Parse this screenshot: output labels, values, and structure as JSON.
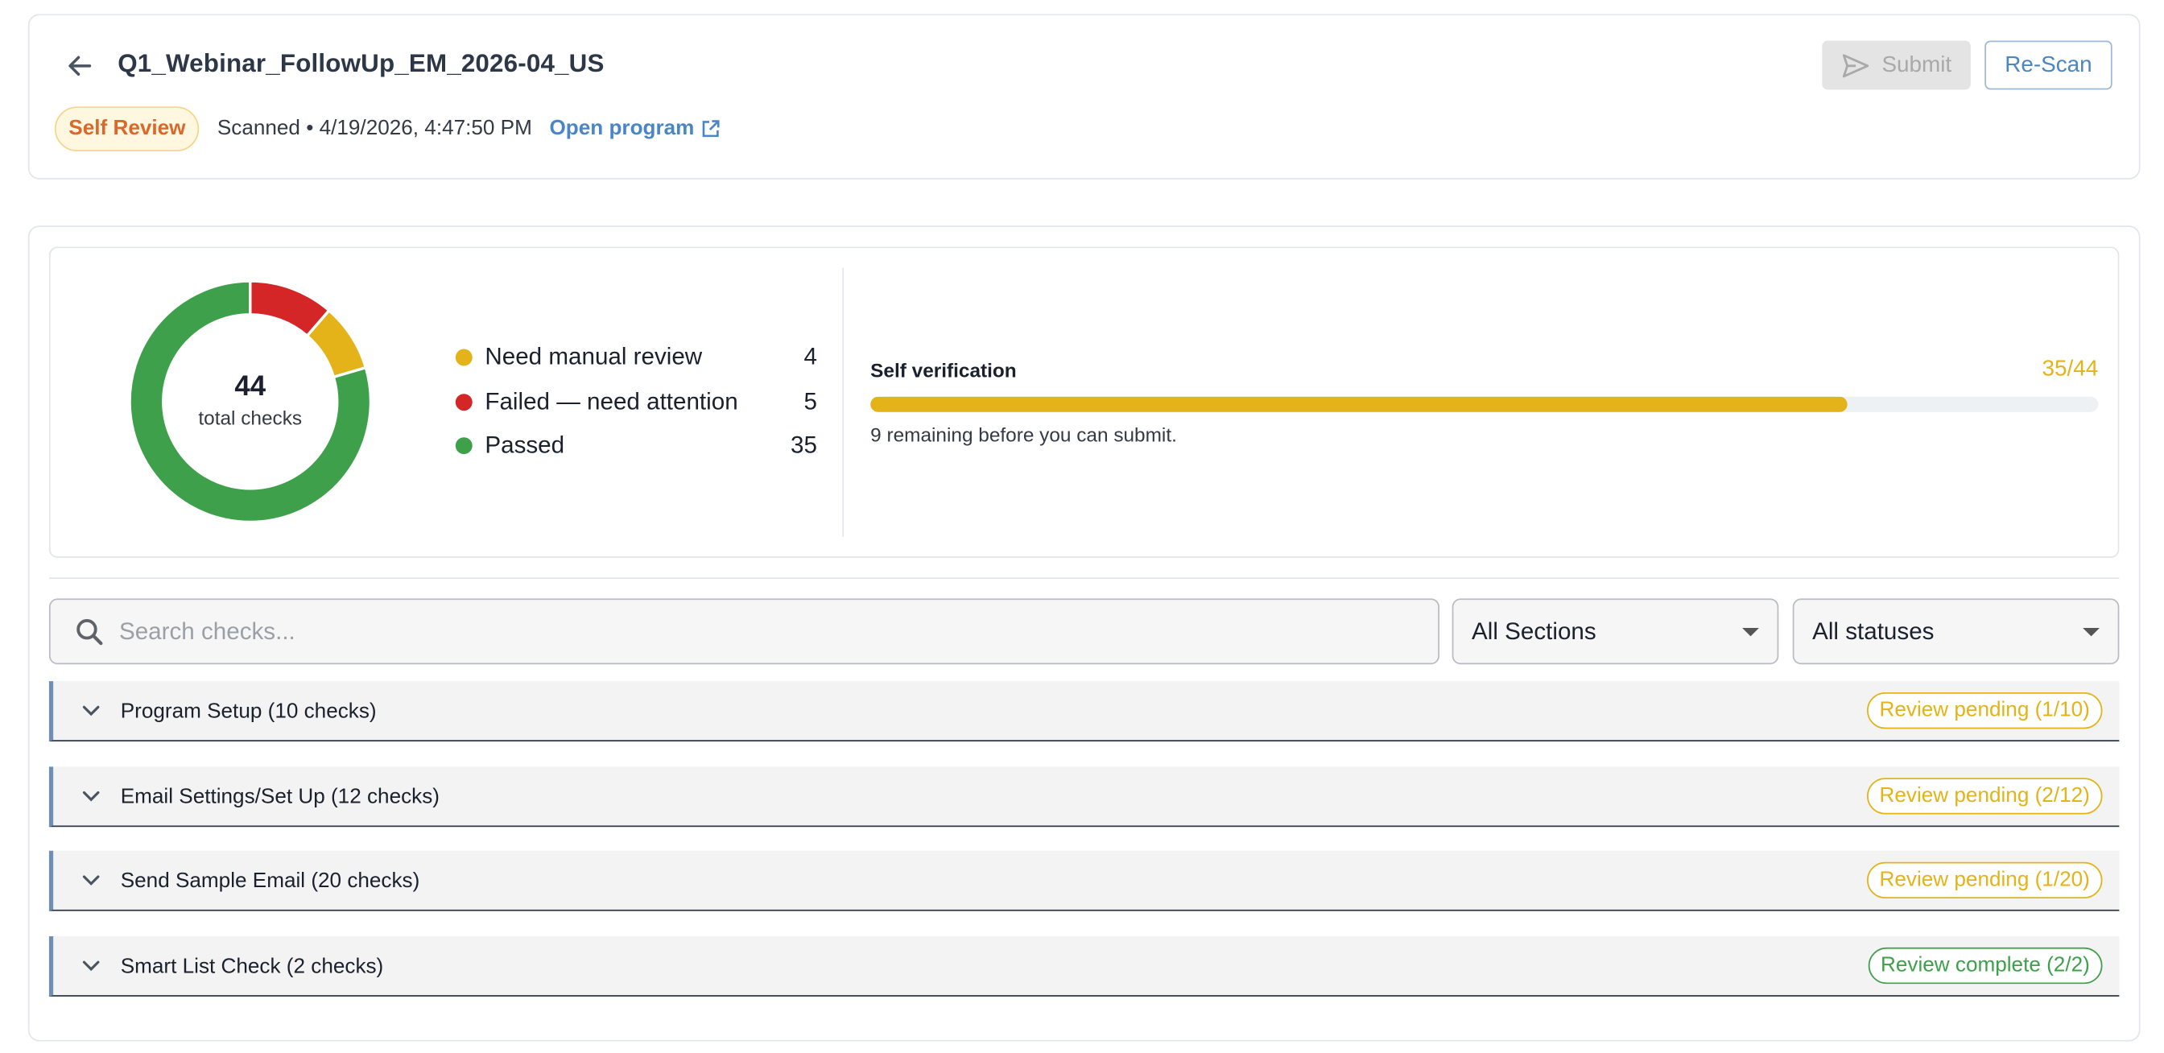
{
  "header": {
    "title": "Q1_Webinar_FollowUp_EM_2026-04_US",
    "badge": "Self Review",
    "scanned_text": "Scanned • 4/19/2026, 4:47:50 PM",
    "open_program_label": "Open program",
    "submit_label": "Submit",
    "rescan_label": "Re-Scan"
  },
  "summary": {
    "total": "44",
    "total_label": "total checks",
    "legend": [
      {
        "label": "Need manual review",
        "count": "4",
        "color": "#e3b319"
      },
      {
        "label": "Failed — need attention",
        "count": "5",
        "color": "#d42626"
      },
      {
        "label": "Passed",
        "count": "35",
        "color": "#3ea04a"
      }
    ]
  },
  "self_verification": {
    "title": "Self verification",
    "count_text": "35/44",
    "progress_fraction": 0.7955,
    "remaining_text": "9 remaining before you can submit."
  },
  "filters": {
    "search_placeholder": "Search checks...",
    "section_select": "All Sections",
    "status_select": "All statuses"
  },
  "sections": [
    {
      "label": "Program Setup (10 checks)",
      "status": "Review pending (1/10)",
      "state": "pending"
    },
    {
      "label": "Email Settings/Set Up (12 checks)",
      "status": "Review pending (2/12)",
      "state": "pending"
    },
    {
      "label": "Send Sample Email (20 checks)",
      "status": "Review pending (1/20)",
      "state": "pending"
    },
    {
      "label": "Smart List Check (2 checks)",
      "status": "Review complete (2/2)",
      "state": "complete"
    }
  ],
  "colors": {
    "pending": "#e3b319",
    "failed": "#d42626",
    "passed": "#3ea04a",
    "accent": "#4a86c5",
    "badge_text": "#d9682a"
  },
  "icons": {
    "back": "arrow-left-icon",
    "external": "external-link-icon",
    "submit": "send-icon",
    "search": "search-icon",
    "select": "caret-down-icon",
    "section": "chevron-down-icon"
  }
}
